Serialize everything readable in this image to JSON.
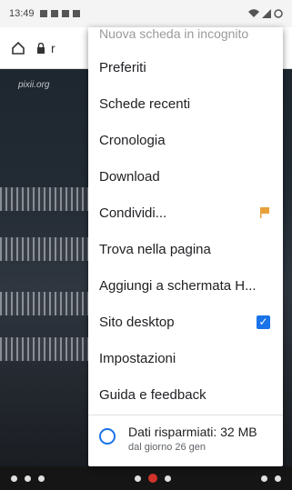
{
  "statusbar": {
    "time": "13:49"
  },
  "toolbar": {
    "url_partial": "r"
  },
  "site": {
    "logo_text": "pixii.org"
  },
  "menu": {
    "top_partial": "Nuova scheda in incognito",
    "items": [
      {
        "label": "Preferiti"
      },
      {
        "label": "Schede recenti"
      },
      {
        "label": "Cronologia"
      },
      {
        "label": "Download"
      },
      {
        "label": "Condividi..."
      },
      {
        "label": "Trova nella pagina"
      },
      {
        "label": "Aggiungi a schermata H..."
      },
      {
        "label": "Sito desktop",
        "checked": true
      },
      {
        "label": "Impostazioni"
      },
      {
        "label": "Guida e feedback"
      }
    ],
    "savings": {
      "title": "Dati risparmiati: 32 MB",
      "subtitle": "dal giorno 26 gen"
    }
  },
  "colors": {
    "checkbox_blue": "#1a73e8",
    "flag_orange": "#e8a13a"
  }
}
